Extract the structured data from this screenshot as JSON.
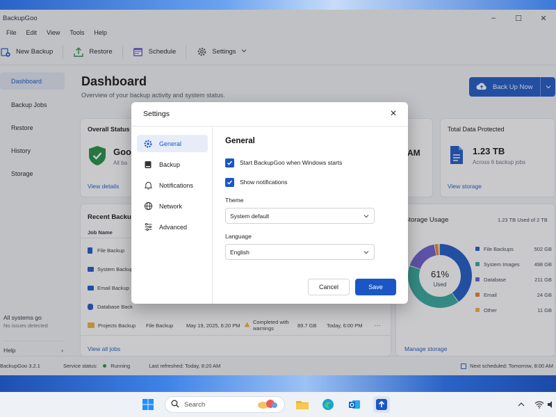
{
  "app": {
    "title": "BackupGoo",
    "window_controls": [
      "–",
      "☐",
      "✕"
    ]
  },
  "menu": [
    "File",
    "Edit",
    "View",
    "Tools",
    "Help"
  ],
  "toolbar": {
    "new_backup": "New Backup",
    "restore": "Restore",
    "schedule": "Schedule",
    "settings": "Settings"
  },
  "sidebar": {
    "items": [
      {
        "label": "Dashboard",
        "icon": "home-icon"
      },
      {
        "label": "Backup Jobs",
        "icon": "jobs-icon"
      },
      {
        "label": "Restore",
        "icon": "restore-icon"
      },
      {
        "label": "History",
        "icon": "history-icon"
      },
      {
        "label": "Storage",
        "icon": "storage-icon"
      }
    ],
    "status_title": "All systems go",
    "status_sub": "No issues detected",
    "help": "Help"
  },
  "main": {
    "title": "Dashboard",
    "subtitle": "Overview of your backup activity and system status.",
    "backup_now": "Back Up Now",
    "overall": {
      "title": "Overall Status",
      "status": "Good",
      "status_sub": "All ba",
      "link": "View details"
    },
    "next_card": {
      "value": "AM"
    },
    "total": {
      "title": "Total Data Protected",
      "value": "1.23 TB",
      "sub": "Across 6 backup jobs",
      "link": "View storage"
    },
    "recent": {
      "title": "Recent Backup",
      "col_job": "Job Name",
      "rows": [
        {
          "name": "File Backup",
          "type": "",
          "date": "",
          "status": "",
          "size": "",
          "next": ""
        },
        {
          "name": "System Backup",
          "type": "",
          "date": "",
          "status": "",
          "size": "",
          "next": ""
        },
        {
          "name": "Email Backup",
          "type": "",
          "date": "",
          "status": "",
          "size": "",
          "next": ""
        },
        {
          "name": "Database Back",
          "type": "",
          "date": "",
          "status": "",
          "size": "",
          "next": ""
        },
        {
          "name": "Projects Backup",
          "type": "File Backup",
          "date": "May 19, 2025, 6:20 PM",
          "status": "Completed with warnings",
          "size": "89.7 GB",
          "next": "Today, 6:00 PM"
        }
      ],
      "link": "View all jobs"
    },
    "storage": {
      "title": "Storage Usage",
      "summary": "1.23 TB Used of 2 TB",
      "percent_label": "61%",
      "used_label": "Used",
      "link": "Manage storage"
    }
  },
  "chart_data": {
    "type": "pie",
    "categories": [
      "File Backups",
      "System Images",
      "Database",
      "Email",
      "Other"
    ],
    "values": [
      502,
      498,
      211,
      24,
      11
    ],
    "value_labels": [
      "502 GB",
      "498 GB",
      "211 GB",
      "24 GB",
      "11 GB"
    ],
    "colors": [
      "#1a56c6",
      "#2ea89a",
      "#6a5acd",
      "#f07c22",
      "#f2b233"
    ],
    "used_fraction": 0.61
  },
  "statusbar": {
    "version": "BackupGoo 3.2.1",
    "service_label": "Service status:",
    "service_value": "Running",
    "refreshed": "Last refreshed: Today, 8:20 AM",
    "next": "Next scheduled: Tomorrow, 8:00 AM"
  },
  "dialog": {
    "title": "Settings",
    "nav": [
      {
        "label": "General",
        "icon": "gear-icon"
      },
      {
        "label": "Backup",
        "icon": "drive-icon"
      },
      {
        "label": "Notifications",
        "icon": "bell-icon"
      },
      {
        "label": "Network",
        "icon": "globe-icon"
      },
      {
        "label": "Advanced",
        "icon": "sliders-icon"
      }
    ],
    "section": "General",
    "start_on_boot": "Start BackupGoo when Windows starts",
    "show_notifications": "Show notifications",
    "theme_label": "Theme",
    "theme_value": "System default",
    "language_label": "Language",
    "language_value": "English",
    "cancel": "Cancel",
    "save": "Save"
  },
  "taskbar": {
    "search_placeholder": "Search"
  }
}
